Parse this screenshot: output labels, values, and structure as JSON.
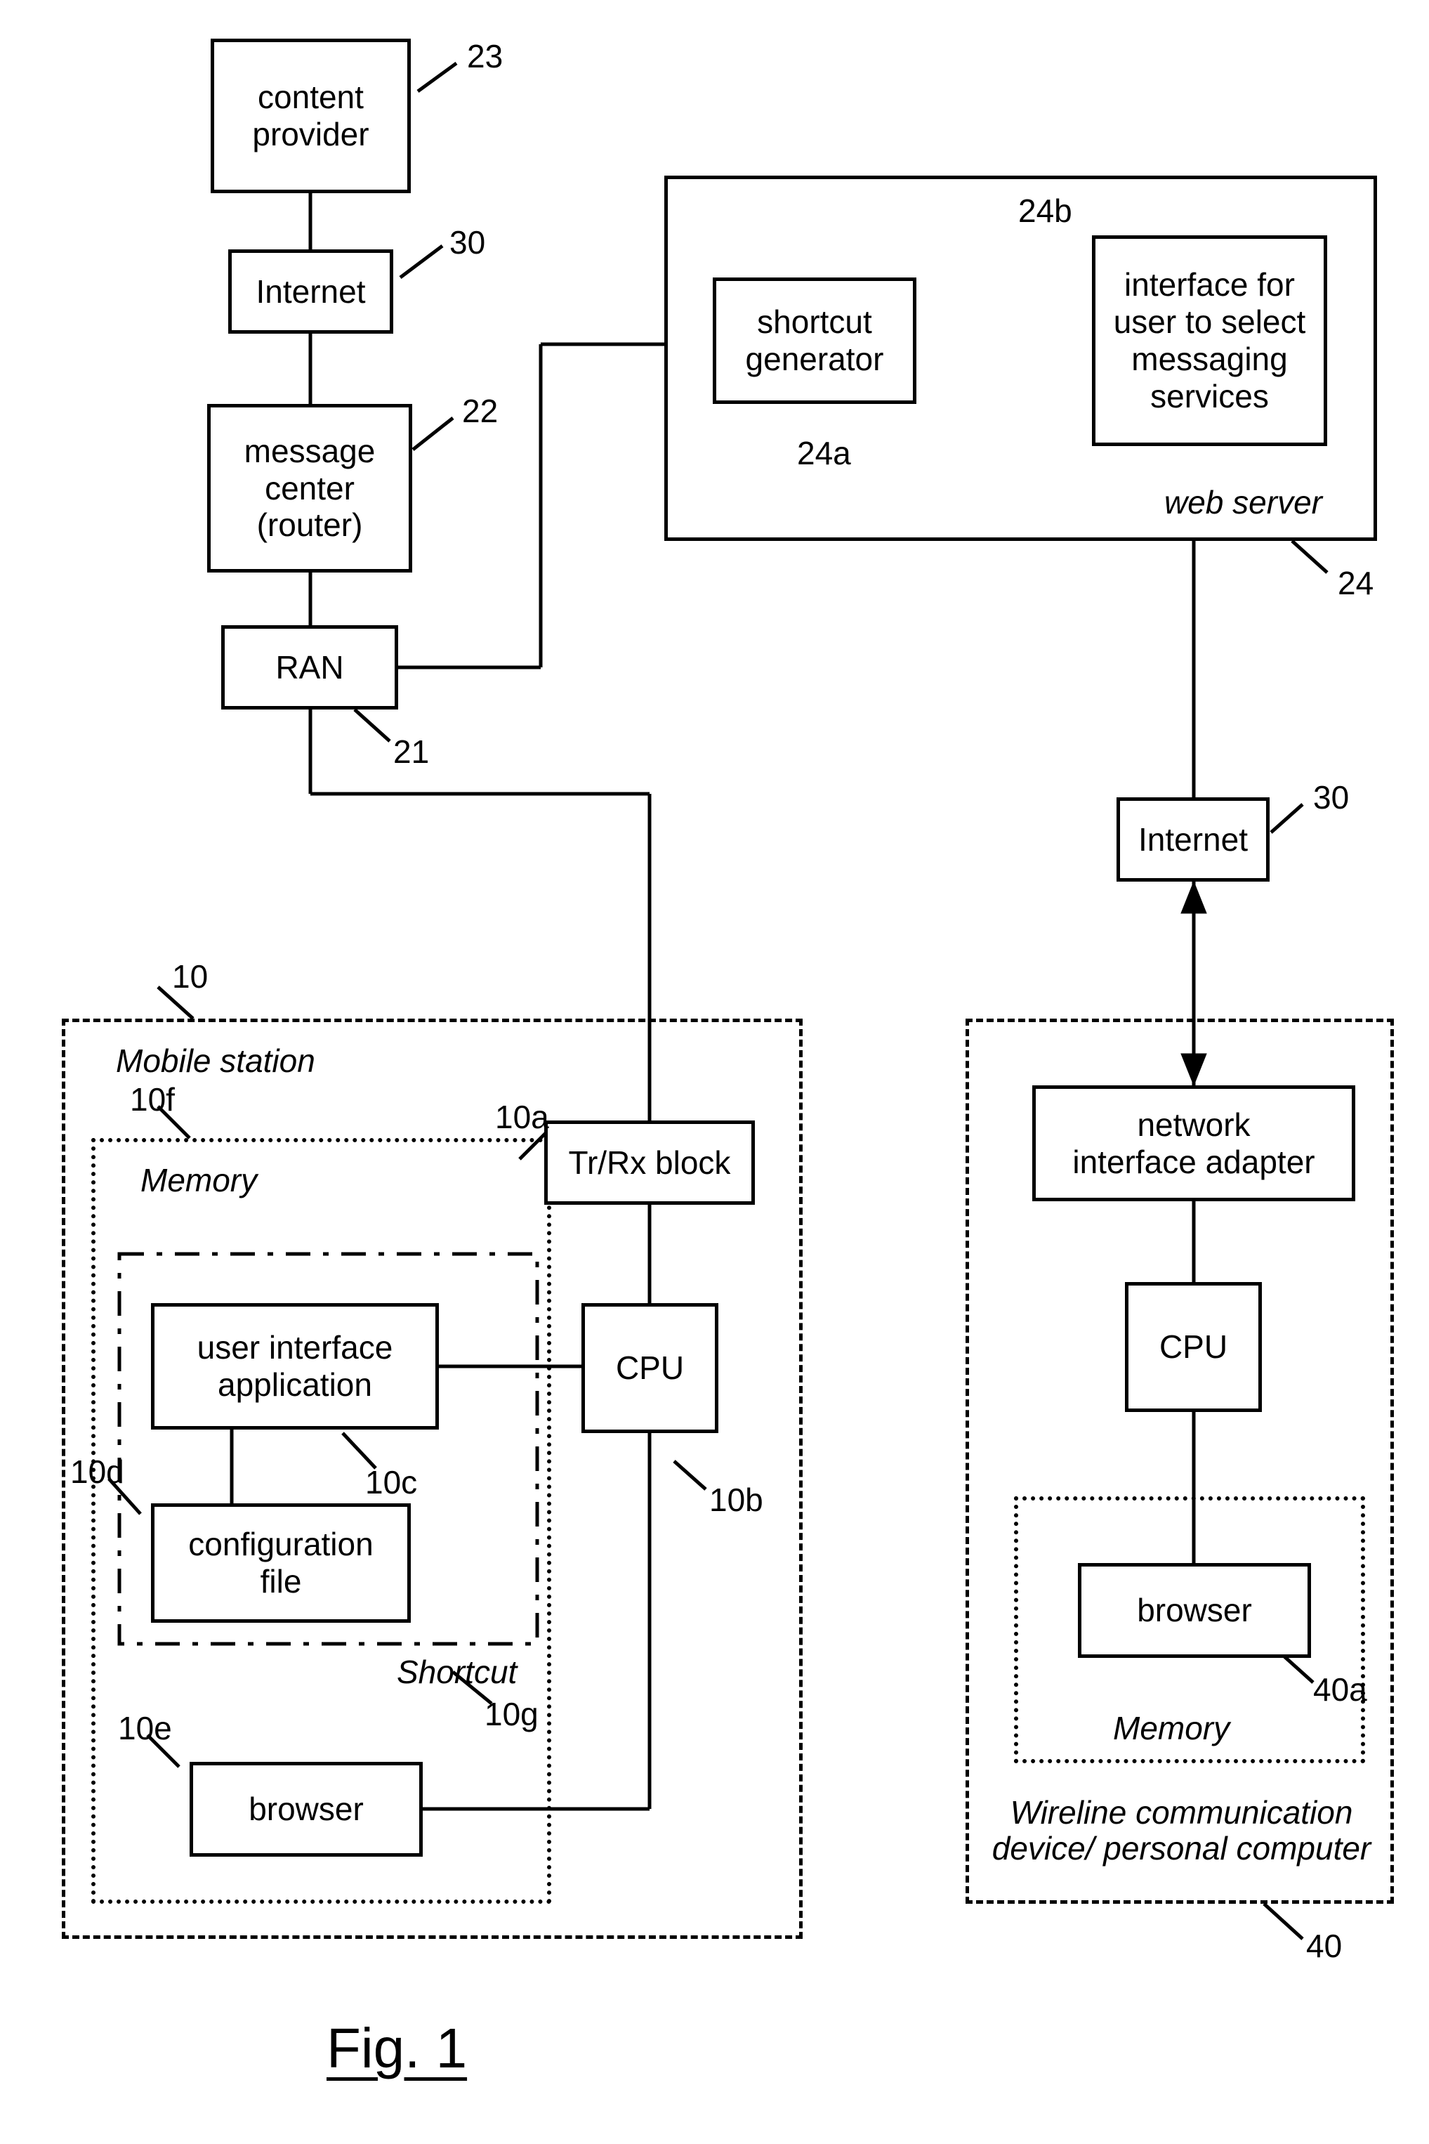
{
  "figure_caption": "Fig. 1",
  "blocks": {
    "content_provider": {
      "text": "content\nprovider",
      "ref": "23"
    },
    "internet_top": {
      "text": "Internet",
      "ref": "30"
    },
    "message_center": {
      "text": "message\ncenter\n(router)",
      "ref": "22"
    },
    "ran": {
      "text": "RAN",
      "ref": "21"
    },
    "web_server": {
      "label": "web server",
      "ref": "24"
    },
    "shortcut_generator": {
      "text": "shortcut\ngenerator",
      "ref": "24a"
    },
    "interface_select": {
      "text": "interface for\nuser to select\nmessaging\nservices",
      "ref": "24b"
    },
    "internet_right": {
      "text": "Internet",
      "ref": "30"
    },
    "mobile_station": {
      "label": "Mobile station",
      "ref": "10"
    },
    "memory_ms": {
      "label": "Memory",
      "ref": "10f"
    },
    "shortcut_box": {
      "label": "Shortcut",
      "ref": "10g"
    },
    "trrx": {
      "text": "Tr/Rx block",
      "ref": "10a"
    },
    "cpu_ms": {
      "text": "CPU",
      "ref": "10b"
    },
    "ui_app": {
      "text": "user interface\napplication",
      "ref": "10c"
    },
    "config_file": {
      "text": "configuration\nfile",
      "ref": "10d"
    },
    "browser_ms": {
      "text": "browser",
      "ref": "10e"
    },
    "wireline_device": {
      "label": "Wireline communication\ndevice/ personal computer",
      "ref": "40"
    },
    "nic": {
      "text": "network\ninterface adapter"
    },
    "cpu_pc": {
      "text": "CPU"
    },
    "memory_pc": {
      "label": "Memory"
    },
    "browser_pc": {
      "text": "browser",
      "ref": "40a"
    }
  }
}
